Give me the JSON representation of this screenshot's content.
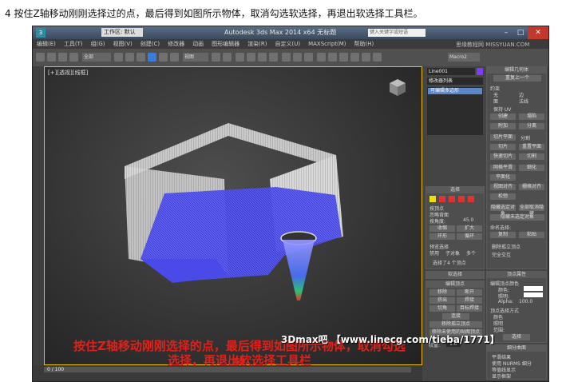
{
  "caption": "4 按住Z轴移动刚刚选择过的点，最后得到如图所示物体，取消勾选软选择，再退出软选择工具栏。",
  "window": {
    "app_logo": "3",
    "quick_access": "工作区: 默认",
    "title": "Autodesk 3ds Max  2014 x64    无标题",
    "search_placeholder": "键入关键字或短语",
    "buttons": {
      "minimize": "–",
      "maximize": "□",
      "close": "✕"
    }
  },
  "menubar": {
    "items": [
      "编辑(E)",
      "工具(T)",
      "组(G)",
      "视图(V)",
      "创建(C)",
      "修改器",
      "动画",
      "图形编辑器",
      "渲染(R)",
      "自定义(U)",
      "MAXScript(M)",
      "帮助(H)"
    ]
  },
  "toolbar": {
    "selection_filter": "全部",
    "ref_coord": "视图",
    "named_set": "Macro2"
  },
  "viewport": {
    "label": "[+][透视][线框]",
    "overlay_line1": "按住Z轴移动刚刚选择的点，最后得到如图所示物体，取消勾选软",
    "overlay_line2": "选择，再退出软选择工具栏"
  },
  "command_panel": {
    "object_name": "Line001",
    "modifier_list": "修改器列表",
    "stack_item": "可编辑多边形",
    "rollout_edit_geometry": {
      "title": "编辑几何体",
      "repeat_last": "重复上一个",
      "constraints": "约束",
      "opt_none": "无",
      "opt_edge": "边",
      "opt_face": "面",
      "opt_normal": "法线",
      "keep_uv": "保持 UV",
      "create": "创建",
      "collapse": "塌陷",
      "attach": "附加",
      "detach": "分离",
      "slice_plane": "切片平面",
      "split": "分割",
      "slice": "切片",
      "reset_plane": "重置平面",
      "quickslice": "快速切片",
      "cut": "切割",
      "meshsmooth": "网格平滑",
      "tessellate": "细化",
      "planarize": "平面化",
      "view_align": "视图对齐",
      "grid_align": "栅格对齐",
      "relax": "松弛",
      "hide_selected": "隐藏选定对象",
      "unhide_all": "全部取消隐藏",
      "hide_unselected": "隐藏未选定对象",
      "named_sel": "命名选择:",
      "copy": "复制",
      "paste": "粘贴",
      "delete_isolated": "删除孤立顶点",
      "full_interactivity": "完全交互"
    },
    "rollout_selection": {
      "title": "选择",
      "by_vertex": "按顶点",
      "ignore_backfacing": "忽略背面",
      "by_angle": "按角度:",
      "angle_value": "45.0",
      "shrink": "收缩",
      "grow": "扩大",
      "ring": "环形",
      "loop": "循环",
      "preview_selection": "预览选择",
      "disabled": "禁用",
      "subobject": "子对象",
      "multi": "多个",
      "status": "选择了4 个顶点"
    },
    "rollout_soft_selection": {
      "title": "软选择"
    },
    "rollout_edit_vertices": {
      "title": "编辑顶点",
      "remove": "移除",
      "break": "断开",
      "extrude": "挤出",
      "weld": "焊接",
      "chamfer": "切角",
      "target_weld": "目标焊接",
      "connect": "连接",
      "remove_isolated": "移除孤立顶点",
      "remove_unused_map": "移除未使用的贴图顶点",
      "weight_label": "权重:",
      "weight_value": "1.0"
    },
    "rollout_vertex_props": {
      "title": "顶点属性",
      "edit_color": "编辑顶点颜色",
      "color": "颜色:",
      "illumination": "照明:",
      "alpha": "Alpha:",
      "alpha_value": "100.0",
      "select_by": "顶点选择方式",
      "opt_color": "颜色",
      "opt_illum": "照明",
      "range": "范围:",
      "select": "选择"
    },
    "rollout_subdivision": {
      "title": "细分曲面",
      "smooth_result": "平滑结果",
      "use_nurms": "使用 NURMS 细分",
      "isoline": "等值线显示",
      "show_cage": "显示框架"
    }
  },
  "statusbar": {
    "time": "0 / 100"
  },
  "watermarks": {
    "top_right": "思缘教程网 MISSYUAN.COM",
    "bottom": "3Dmax吧 【www.linecg.com/tieba/1771】"
  }
}
